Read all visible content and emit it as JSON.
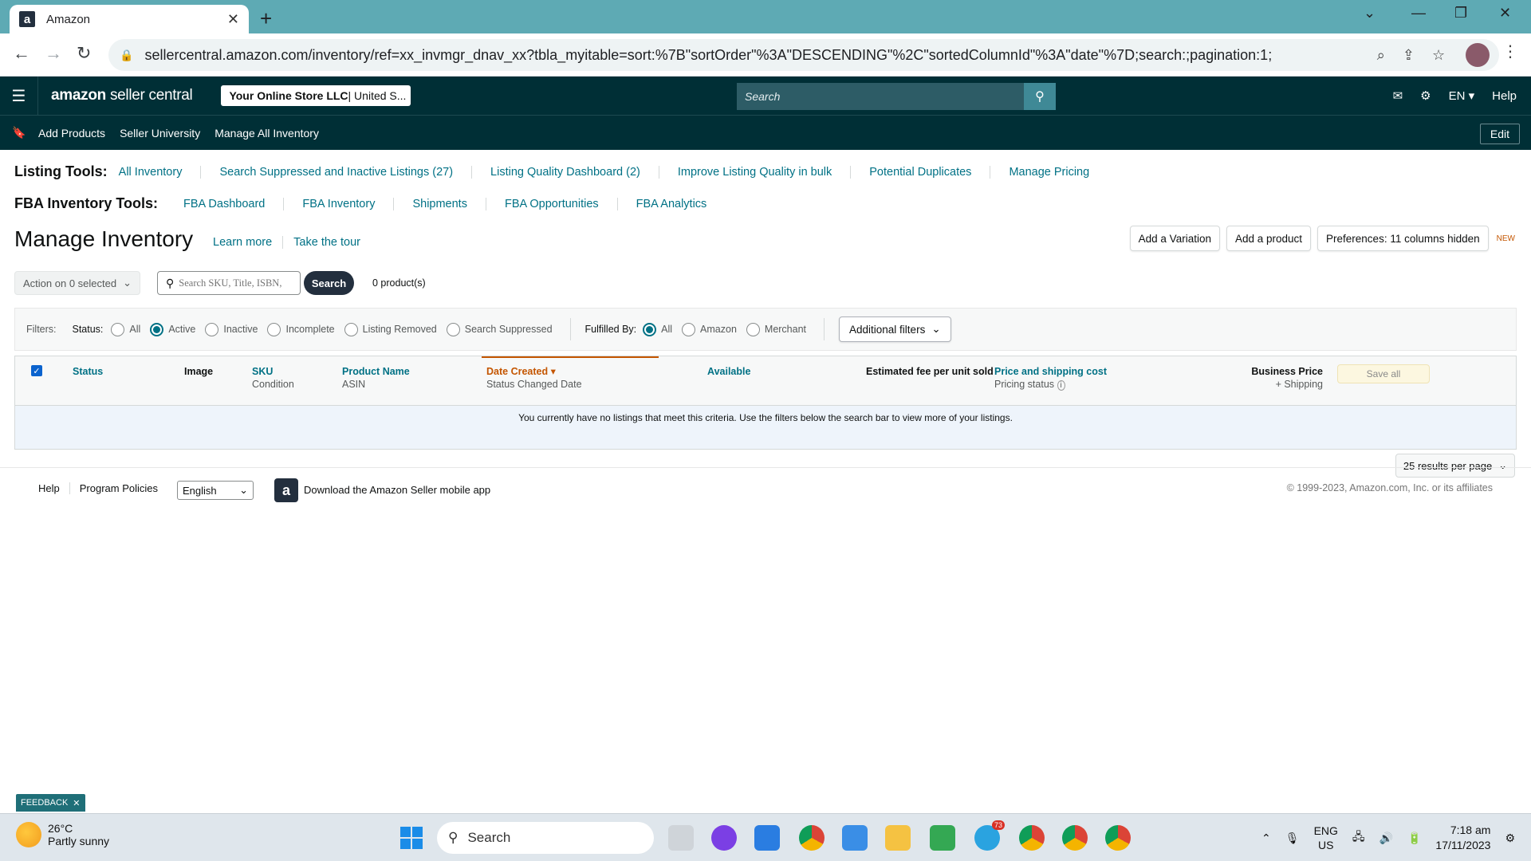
{
  "browser": {
    "tab_title": "Amazon",
    "url": "sellercentral.amazon.com/inventory/ref=xx_invmgr_dnav_xx?tbla_myitable=sort:%7B\"sortOrder\"%3A\"DESCENDING\"%2C\"sortedColumnId\"%3A\"date\"%7D;search:;pagination:1;"
  },
  "header": {
    "logo_main": "amazon",
    "logo_sub": "seller central",
    "store_bold": "Your Online Store LLC",
    "store_rest": " | United S...",
    "search_placeholder": "Search",
    "lang": "EN",
    "help": "Help"
  },
  "bookmarks": {
    "items": [
      "Add Products",
      "Seller University",
      "Manage All Inventory"
    ],
    "edit": "Edit"
  },
  "listing_tools": {
    "label": "Listing Tools:",
    "links": [
      "All Inventory",
      "Search Suppressed and Inactive Listings (27)",
      "Listing Quality Dashboard (2)",
      "Improve Listing Quality in bulk",
      "Potential Duplicates",
      "Manage Pricing"
    ]
  },
  "fba_tools": {
    "label": "FBA Inventory Tools:",
    "links": [
      "FBA Dashboard",
      "FBA Inventory",
      "Shipments",
      "FBA Opportunities",
      "FBA Analytics"
    ]
  },
  "page": {
    "title": "Manage Inventory",
    "learn_more": "Learn more",
    "take_tour": "Take the tour",
    "add_variation": "Add a Variation",
    "add_product": "Add a product",
    "preferences": "Preferences: 11 columns hidden",
    "new_badge": "NEW"
  },
  "actions": {
    "action_select": "Action on 0 selected",
    "search_placeholder": "Search SKU, Title, ISBN,",
    "search_button": "Search",
    "product_count": "0 product(s)"
  },
  "filters": {
    "label": "Filters:",
    "status_label": "Status:",
    "status_options": [
      "All",
      "Active",
      "Inactive",
      "Incomplete",
      "Listing Removed",
      "Search Suppressed"
    ],
    "status_selected": "Active",
    "fulfilled_label": "Fulfilled By:",
    "fulfilled_options": [
      "All",
      "Amazon",
      "Merchant"
    ],
    "fulfilled_selected": "All",
    "additional": "Additional filters"
  },
  "table": {
    "columns": {
      "status": "Status",
      "image": "Image",
      "sku": "SKU",
      "sku_sub": "Condition",
      "product_name": "Product Name",
      "product_sub": "ASIN",
      "date_created": "Date Created",
      "date_sub": "Status Changed Date",
      "available": "Available",
      "fee": "Estimated fee per unit sold",
      "price": "Price and shipping cost",
      "price_sub": "Pricing status",
      "business": "Business Price",
      "business_sub": "+ Shipping"
    },
    "save_all": "Save all",
    "empty_message": "You currently have no listings that meet this criteria. Use the filters below the search bar to view more of your listings.",
    "per_page": "25 results per page"
  },
  "footer": {
    "help": "Help",
    "policies": "Program Policies",
    "language": "English",
    "app_text": "Download the Amazon Seller mobile app",
    "copyright": "© 1999-2023, Amazon.com, Inc. or its affiliates"
  },
  "feedback": "FEEDBACK",
  "taskbar": {
    "temp": "26°C",
    "weather": "Partly sunny",
    "search": "Search",
    "lang1": "ENG",
    "lang2": "US",
    "time": "7:18 am",
    "date": "17/11/2023",
    "telegram_badge": "73"
  }
}
